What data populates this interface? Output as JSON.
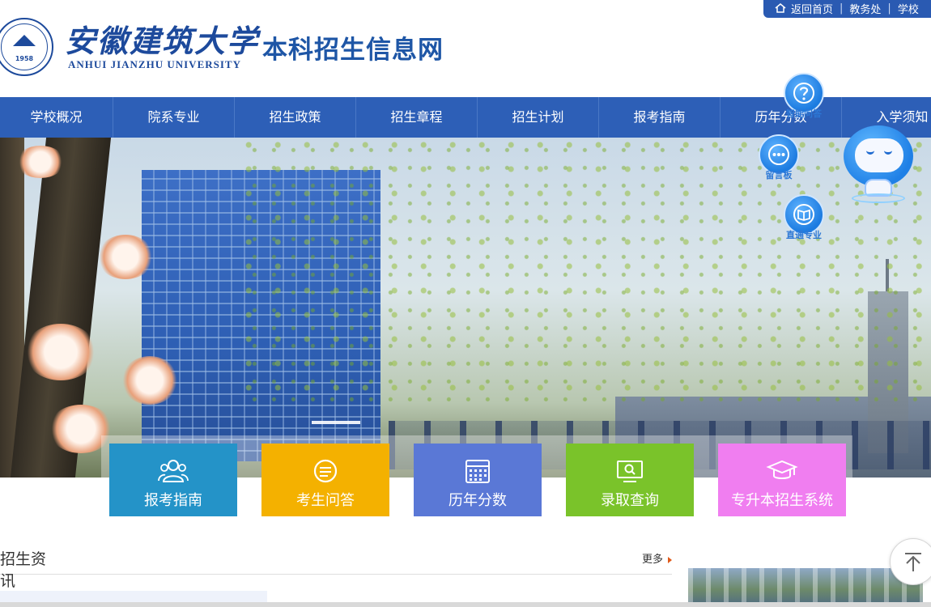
{
  "header": {
    "school_name_cn": "安徽建筑大学",
    "school_name_en": "ANHUI JIANZHU UNIVERSITY",
    "emblem_year": "1958",
    "site_title": "本科招生信息网"
  },
  "toplinks": [
    {
      "label": "返回首页",
      "icon": "home-icon"
    },
    {
      "label": "教务处"
    },
    {
      "label": "学校"
    }
  ],
  "nav": {
    "items": [
      "学校概况",
      "院系专业",
      "招生政策",
      "招生章程",
      "招生计划",
      "报考指南",
      "历年分数",
      "入学须知"
    ]
  },
  "quick_links": [
    {
      "label": "报考指南",
      "icon": "users-icon",
      "color": "#2493c8"
    },
    {
      "label": "考生问答",
      "icon": "chat-icon",
      "color": "#f4b100"
    },
    {
      "label": "历年分数",
      "icon": "calendar-icon",
      "color": "#5a78d6"
    },
    {
      "label": "录取查询",
      "icon": "monitor-search-icon",
      "color": "#7ac32a"
    },
    {
      "label": "专升本招生系统",
      "icon": "graduation-cap-icon",
      "color": "#f07ef0"
    }
  ],
  "news": {
    "title": "招生资讯",
    "more": "更多"
  },
  "floating": {
    "qa_label": "智能问答",
    "message_label": "留言板",
    "major_label": "直通专业"
  },
  "colors": {
    "primary": "#2d5fb7",
    "brand_text": "#1d4a9c"
  }
}
